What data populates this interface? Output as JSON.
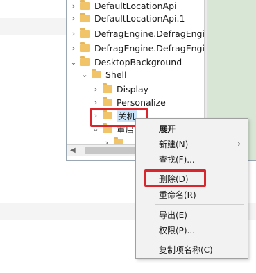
{
  "tree": {
    "rows": [
      {
        "label": "DefaultLocationApi"
      },
      {
        "label": "DefaultLocationApi.1"
      },
      {
        "label": "DefragEngine.DefragEngine"
      },
      {
        "label": "DefragEngine.DefragEngine"
      },
      {
        "label": "DesktopBackground"
      },
      {
        "label": "Shell"
      },
      {
        "label": "Display"
      },
      {
        "label": "Personalize"
      },
      {
        "label": "关机"
      },
      {
        "label": "重启"
      }
    ]
  },
  "menu": {
    "items": [
      {
        "label": "展开"
      },
      {
        "label": "新建(N)"
      },
      {
        "label": "查找(F)..."
      },
      {
        "label": "删除(D)"
      },
      {
        "label": "重命名(R)"
      },
      {
        "label": "导出(E)"
      },
      {
        "label": "权限(P)..."
      },
      {
        "label": "复制项名称(C)"
      }
    ]
  },
  "colors": {
    "highlight_border": "#d9262c",
    "selection": "#cce4f7",
    "right_pane": "#d8e6d6",
    "folder": "#f2c46a"
  }
}
